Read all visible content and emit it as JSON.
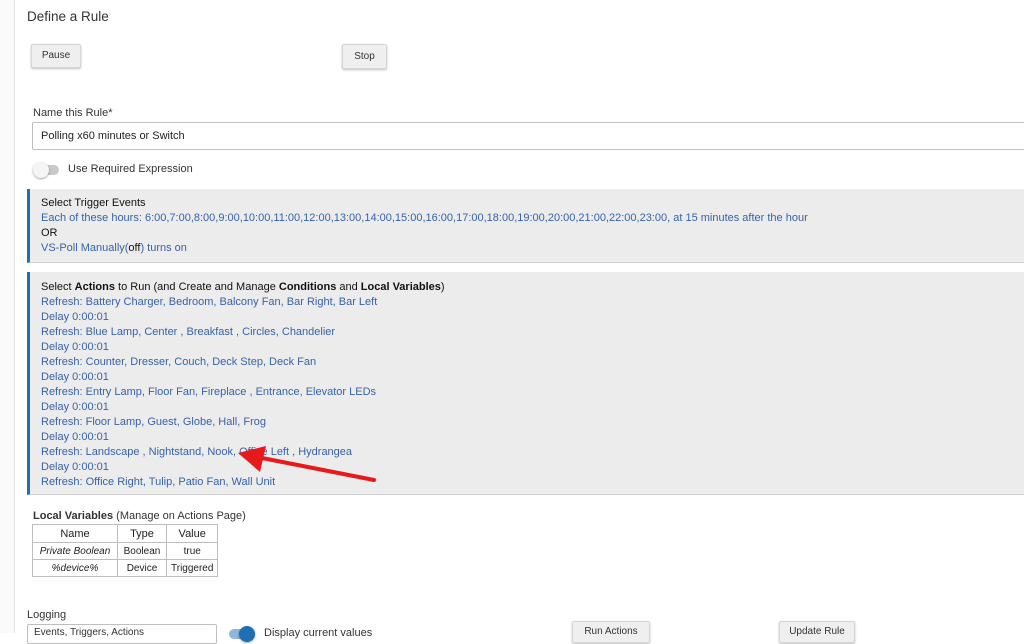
{
  "page": {
    "title": "Define a Rule"
  },
  "controls": {
    "pause_label": "Pause",
    "stop_label": "Stop"
  },
  "name_field": {
    "label": "Name this Rule*",
    "value": "Polling x60 minutes or Switch"
  },
  "required_expression": {
    "label": "Use Required Expression",
    "enabled": false
  },
  "trigger": {
    "title": "Select Trigger Events",
    "hours_line": "Each of these hours: 6:00,7:00,8:00,9:00,10:00,11:00,12:00,13:00,14:00,15:00,16:00,17:00,18:00,19:00,20:00,21:00,22:00,23:00, at 15 minutes after the hour",
    "or_text": "OR",
    "device_prefix": "VS-Poll Manually(",
    "device_state": "off",
    "device_suffix": ") turns on"
  },
  "actions": {
    "title_parts": [
      "Select ",
      "Actions",
      " to Run (and Create and Manage ",
      "Conditions",
      " and ",
      "Local Variables",
      ")"
    ],
    "lines": [
      "Refresh: Battery Charger, Bedroom, Balcony Fan, Bar Right, Bar Left",
      "Delay 0:00:01",
      "Refresh: Blue Lamp, Center , Breakfast , Circles, Chandelier",
      "Delay 0:00:01",
      "Refresh: Counter, Dresser, Couch, Deck Step, Deck Fan",
      "Delay 0:00:01",
      "Refresh: Entry Lamp, Floor Fan, Fireplace , Entrance, Elevator LEDs",
      "Delay 0:00:01",
      "Refresh: Floor Lamp, Guest, Globe, Hall, Frog",
      "Delay 0:00:01",
      "Refresh: Landscape , Nightstand, Nook, Office Left , Hydrangea",
      "Delay 0:00:01",
      "Refresh: Office Right, Tulip, Patio Fan, Wall Unit"
    ]
  },
  "local_variables": {
    "title": "Local Variables",
    "subtitle": " (Manage on Actions Page)",
    "headers": [
      "Name",
      "Type",
      "Value"
    ],
    "rows": [
      [
        "Private Boolean",
        "Boolean",
        "true"
      ],
      [
        "%device%",
        "Device",
        "Triggered"
      ]
    ]
  },
  "logging": {
    "label": "Logging",
    "select_value": "Events, Triggers, Actions"
  },
  "display_values": {
    "label": "Display current values",
    "enabled": true
  },
  "footer": {
    "run_label": "Run Actions",
    "update_label": "Update Rule"
  },
  "annotation": {
    "color": "#e8191b"
  },
  "colors": {
    "accent": "#1f6fb5",
    "link": "#3762a8",
    "panel_bg": "#ececec"
  }
}
